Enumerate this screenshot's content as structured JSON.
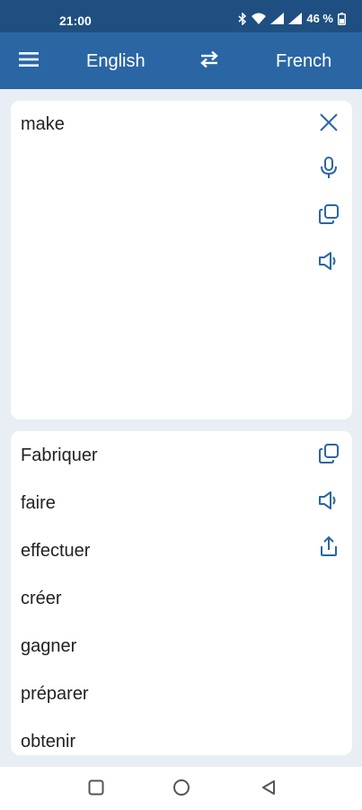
{
  "status_bar": {
    "time": "21:00",
    "battery": "46 %"
  },
  "app_bar": {
    "source_language": "English",
    "target_language": "French",
    "icons": {
      "menu": "menu-icon",
      "swap": "swap-icon"
    }
  },
  "input": {
    "text": "make",
    "icons": [
      "close-icon",
      "microphone-icon",
      "copy-icon",
      "speaker-icon"
    ]
  },
  "results": {
    "items": [
      "Fabriquer",
      "faire",
      "effectuer",
      "créer",
      "gagner",
      "préparer",
      "obtenir"
    ],
    "icons": [
      "copy-icon",
      "speaker-icon",
      "share-icon"
    ]
  },
  "nav_bar": {
    "icons": [
      "recent-apps-icon",
      "home-icon",
      "back-icon"
    ]
  },
  "colors": {
    "header": "#2a66a3",
    "status_bar": "#1f4f80",
    "background": "#e9eef5",
    "accent": "#2a66a3"
  }
}
